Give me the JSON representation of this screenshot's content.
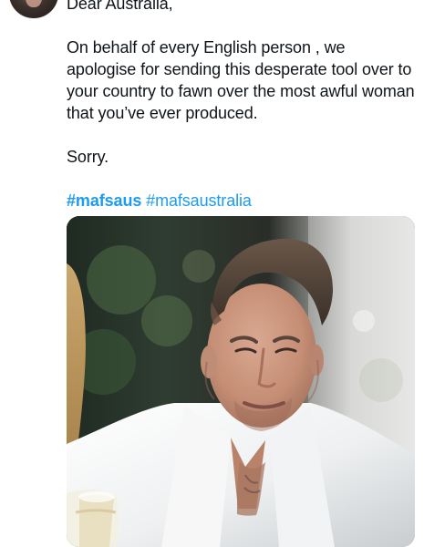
{
  "post": {
    "greeting": "Dear Australia,",
    "body": "On behalf of every English person , we apologise for sending this desperate tool over to your country to fawn over the most awful woman that you’ve ever produced.",
    "signoff": "Sorry.",
    "hashtags": [
      "#mafsaus",
      "#mafsaustralia"
    ]
  },
  "author": {
    "avatar_icon": "profile-avatar"
  },
  "media": {
    "type": "photo",
    "subject": "man in white shirt seated at table"
  },
  "colors": {
    "text": "#0f1419",
    "hashtag": "#1d9bf0",
    "background": "#ffffff"
  }
}
